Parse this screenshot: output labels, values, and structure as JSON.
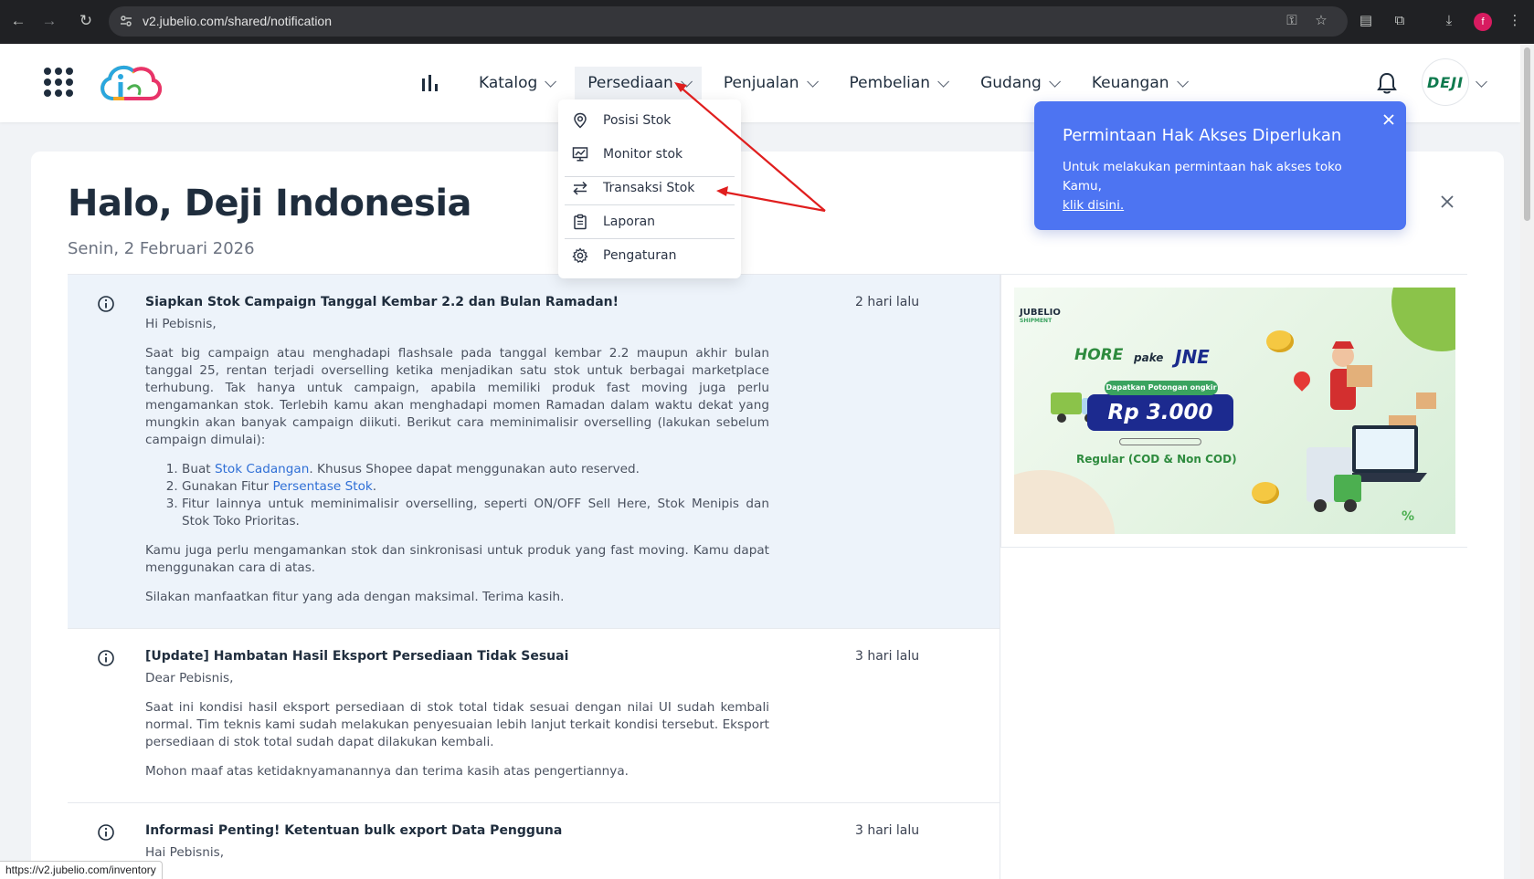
{
  "browser": {
    "url": "v2.jubelio.com/shared/notification",
    "status_url": "https://v2.jubelio.com/inventory",
    "profile_initial": "f"
  },
  "nav": {
    "menu": [
      {
        "label": "Katalog"
      },
      {
        "label": "Persediaan"
      },
      {
        "label": "Penjualan"
      },
      {
        "label": "Pembelian"
      },
      {
        "label": "Gudang"
      },
      {
        "label": "Keuangan"
      }
    ],
    "avatar_text": "DEJI"
  },
  "dropdown": {
    "items": [
      {
        "label": "Posisi Stok",
        "icon": "location-pin-icon"
      },
      {
        "label": "Monitor stok",
        "icon": "monitor-chart-icon"
      },
      {
        "label": "Transaksi Stok",
        "icon": "swap-arrows-icon"
      },
      {
        "label": "Laporan",
        "icon": "clipboard-icon"
      },
      {
        "label": "Pengaturan",
        "icon": "gear-icon"
      }
    ]
  },
  "toast": {
    "title": "Permintaan Hak Akses Diperlukan",
    "body": "Untuk melakukan permintaan hak akses toko Kamu,",
    "link": "klik disini."
  },
  "page": {
    "greeting": "Halo, Deji Indonesia",
    "date": "Senin, 2 Februari 2026"
  },
  "notifications": [
    {
      "title": "Siapkan Stok Campaign Tanggal Kembar 2.2 dan Bulan Ramadan!",
      "time": "2 hari lalu",
      "salutation": "Hi Pebisnis,",
      "p1": "Saat big campaign atau menghadapi flashsale pada tanggal kembar 2.2 maupun akhir bulan tanggal 25, rentan terjadi overselling ketika menjadikan satu stok untuk berbagai marketplace terhubung. Tak hanya untuk campaign, apabila memiliki produk fast moving juga perlu mengamankan stok. Terlebih kamu akan menghadapi momen Ramadan dalam waktu dekat yang mungkin akan banyak campaign diikuti. Berikut cara meminimalisir overselling (lakukan sebelum campaign dimulai):",
      "li1_pre": "Buat ",
      "li1_link": "Stok Cadangan",
      "li1_post": ". Khusus Shopee dapat menggunakan auto reserved.",
      "li2_pre": "Gunakan Fitur ",
      "li2_link": "Persentase Stok",
      "li2_post": ".",
      "li3": "Fitur lainnya untuk meminimalisir overselling, seperti ON/OFF Sell Here, Stok Menipis dan Stok Toko Prioritas.",
      "p2": "Kamu juga perlu mengamankan stok dan sinkronisasi untuk produk yang fast moving. Kamu dapat menggunakan cara di atas.",
      "p3": "Silakan manfaatkan fitur yang ada dengan maksimal. Terima kasih."
    },
    {
      "title": "[Update] Hambatan Hasil Eksport Persediaan Tidak Sesuai",
      "time": "3 hari lalu",
      "salutation": "Dear Pebisnis,",
      "p1": "Saat ini kondisi hasil eksport persediaan di stok total tidak sesuai dengan nilai UI sudah kembali normal. Tim teknis kami sudah melakukan penyesuaian lebih lanjut terkait kondisi tersebut. Eksport persediaan di stok total sudah dapat dilakukan kembali.",
      "p2": "Mohon maaf atas ketidaknyamanannya dan terima kasih atas pengertiannya."
    },
    {
      "title": "Informasi Penting! Ketentuan bulk export Data Pengguna",
      "time": "3 hari lalu",
      "salutation": "Hai Pebisnis,"
    }
  ],
  "banner": {
    "brand": "JUBELIO",
    "brand_sub": "SHIPMENT",
    "hore": "HORE",
    "pake": "pake",
    "jne": "JNE",
    "promo_tag": "Dapatkan Potongan ongkir",
    "price": "Rp 3.000",
    "service": "Regular (COD & Non COD)"
  },
  "colors": {
    "toast_bg": "#4d74f2",
    "link": "#2f6fd6",
    "highlight_row": "#edf3fa",
    "arrow": "#e01e1e"
  }
}
